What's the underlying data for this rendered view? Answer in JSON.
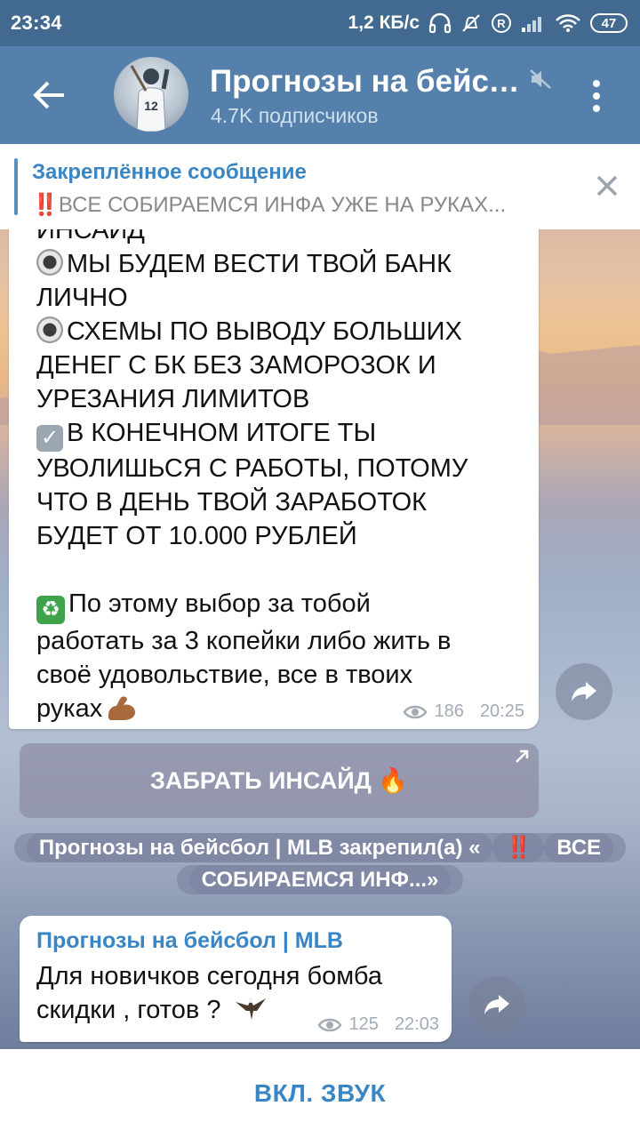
{
  "status_bar": {
    "time": "23:34",
    "speed": "1,2 КБ/с",
    "battery": "47",
    "icons": [
      "headphones-icon",
      "alarm-off-icon",
      "registered-icon",
      "signal-icon",
      "wifi-icon",
      "battery-icon"
    ]
  },
  "header": {
    "title": "Прогнозы на бейсб...",
    "subscribers": "4.7K подписчиков"
  },
  "pinned": {
    "title": "Закреплённое сообщение",
    "bangs": "‼️",
    "text": "ВСЕ СОБИРАЕМСЯ ИНФА УЖЕ НА РУКАХ..."
  },
  "message1": {
    "cut_line": "ИНСАЙД",
    "line1": "МЫ БУДЕМ ВЕСТИ ТВОЙ БАНК",
    "line2": "ЛИЧНО",
    "line3": "СХЕМЫ ПО ВЫВОДУ БОЛЬШИХ",
    "line4": "ДЕНЕГ С БК БЕЗ ЗАМОРОЗОК И",
    "line5": "УРЕЗАНИЯ ЛИМИТОВ",
    "line6": "В КОНЕЧНОМ ИТОГЕ ТЫ",
    "line7": "УВОЛИШЬСЯ С РАБОТЫ, ПОТОМУ",
    "line8": "ЧТО В ДЕНЬ ТВОЙ ЗАРАБОТОК",
    "line9": "БУДЕТ ОТ 10.000 РУБЛЕЙ",
    "line10": "По этому выбор за тобой",
    "line11": "работать за 3 копейки либо жить в",
    "line12": "своё удовольствие, все в твоих",
    "line13": "руках",
    "views": "186",
    "time": "20:25"
  },
  "inline_button": {
    "label": "ЗАБРАТЬ ИНСАЙД 🔥"
  },
  "service": {
    "text_before": "Прогнозы на бейсбол | MLB закрепил(а) «",
    "bangs": "‼️",
    "text_after": "ВСЕ СОБИРАЕМСЯ ИНФ...»"
  },
  "message2": {
    "author": "Прогнозы на бейсбол | MLB",
    "line1": "Для новичков сегодня бомба",
    "line2": "скидки , готов ?",
    "views": "125",
    "time": "22:03"
  },
  "bottom": {
    "button_label": "ВКЛ. ЗВУК"
  },
  "colors": {
    "header": "#5580ab",
    "status_bar": "#42698f",
    "accent": "#3a86c5"
  }
}
